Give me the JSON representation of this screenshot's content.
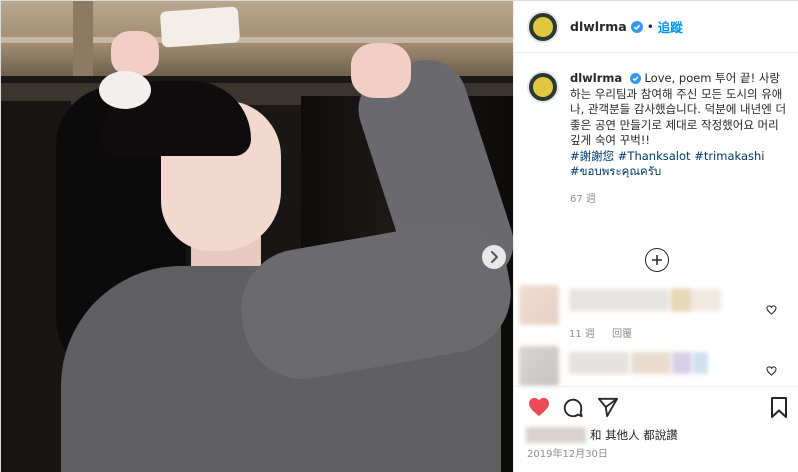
{
  "header": {
    "username": "dlwlrma",
    "separator": "•",
    "follow_label": "追蹤"
  },
  "caption": {
    "username": "dlwlrma",
    "body": "Love, poem 투어 끝! 사랑하는 우리팀과 참여해 주신 모든 도시의 유애나, 관객분들 감사했습니다. 덕분에 내년엔 더 좋은 공연 만들기로 제대로 작정했어요 머리 깊게 숙여 꾸벅!!",
    "tags": [
      "#謝謝您",
      "#Thanksalot",
      "#trimakashi",
      "#ขอบพระคุณครับ"
    ],
    "time": "67 週"
  },
  "comments": [
    {
      "time": "11 週",
      "reply_label": "回覆"
    },
    {}
  ],
  "likes": {
    "text": "和 其他人 都說讚"
  },
  "date": "2019年12月30日",
  "colors": {
    "follow_blue": "#0095f6",
    "liked_red": "#ed4956",
    "hashtag": "#00376b",
    "meta_gray": "#8e8e8e"
  },
  "icons": {
    "next": "chevron-right-icon",
    "verified": "verified-badge-icon",
    "load_more": "plus-circle-icon",
    "like": "heart-icon",
    "comment": "comment-icon",
    "share": "paper-plane-icon",
    "save": "bookmark-icon"
  }
}
